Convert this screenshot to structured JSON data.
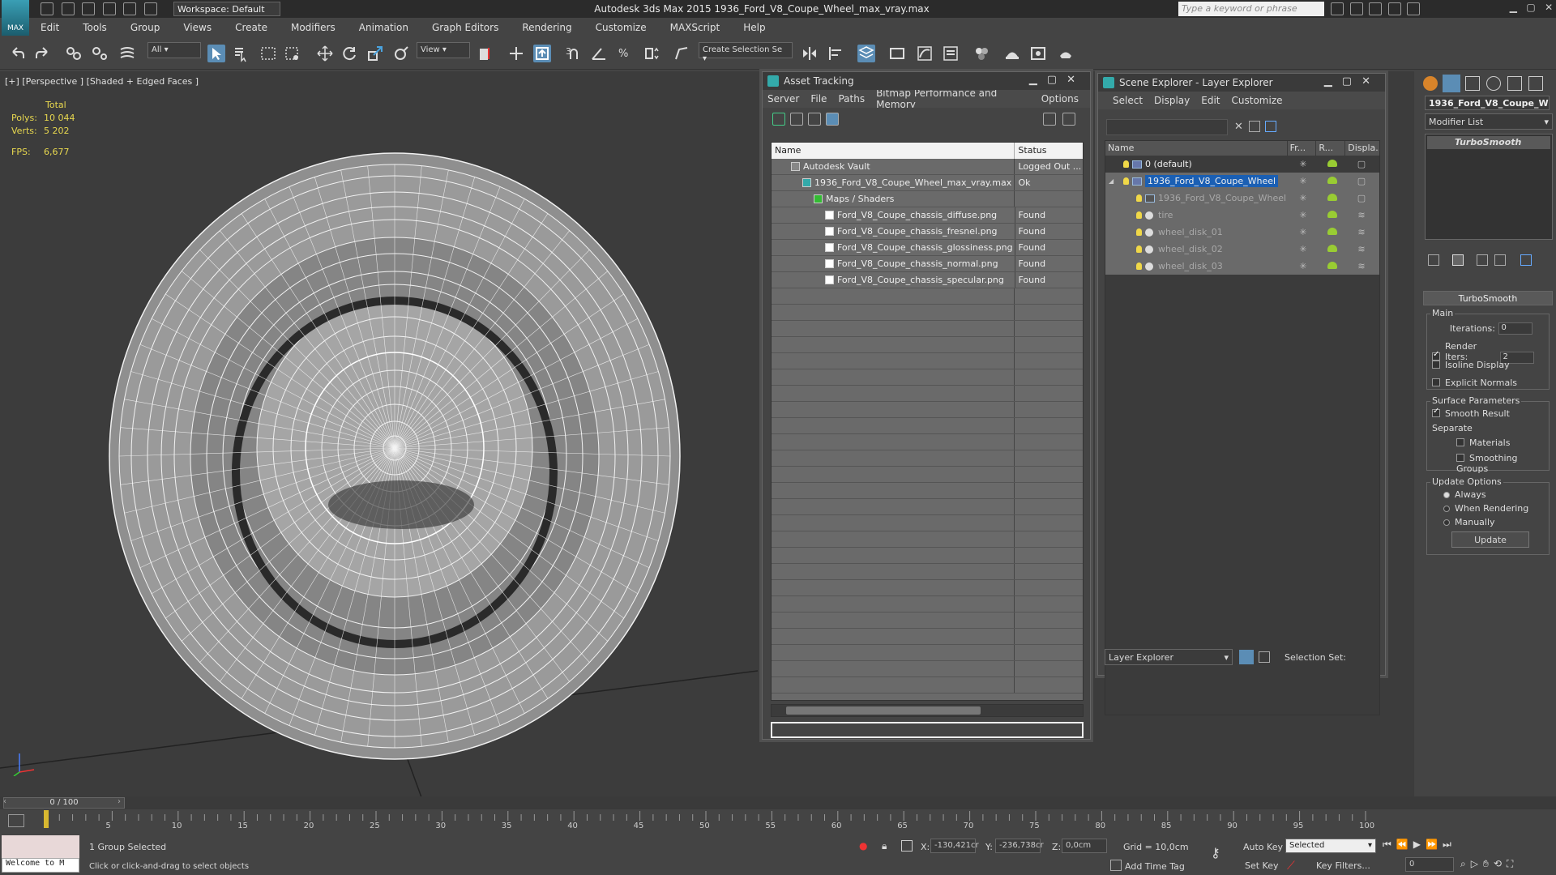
{
  "app": {
    "logo_label": "MAX",
    "workspace": "Workspace: Default",
    "title": "Autodesk 3ds Max  2015    1936_Ford_V8_Coupe_Wheel_max_vray.max",
    "search_placeholder": "Type a keyword or phrase"
  },
  "menu": [
    "Edit",
    "Tools",
    "Group",
    "Views",
    "Create",
    "Modifiers",
    "Animation",
    "Graph Editors",
    "Rendering",
    "Customize",
    "MAXScript",
    "Help"
  ],
  "toolbar": {
    "filter": "All",
    "ref_coord": "View",
    "selection_set": "Create Selection Se"
  },
  "viewport": {
    "label": "[+] [Perspective ] [Shaded + Edged Faces ]",
    "stats_total": "Total",
    "polys_label": "Polys:",
    "polys_value": "10 044",
    "verts_label": "Verts:",
    "verts_value": "5 202",
    "fps_label": "FPS:",
    "fps_value": "6,677"
  },
  "asset_tracking": {
    "title": "Asset Tracking",
    "menu": [
      "Server",
      "File",
      "Paths",
      "Bitmap Performance and Memory",
      "Options"
    ],
    "col_name": "Name",
    "col_status": "Status",
    "rows": [
      {
        "name": "Autodesk Vault",
        "status": "Logged Out ...",
        "indent": 0
      },
      {
        "name": "1936_Ford_V8_Coupe_Wheel_max_vray.max",
        "status": "Ok",
        "indent": 1
      },
      {
        "name": "Maps / Shaders",
        "status": "",
        "indent": 2
      },
      {
        "name": "Ford_V8_Coupe_chassis_diffuse.png",
        "status": "Found",
        "indent": 3
      },
      {
        "name": "Ford_V8_Coupe_chassis_fresnel.png",
        "status": "Found",
        "indent": 3
      },
      {
        "name": "Ford_V8_Coupe_chassis_glossiness.png",
        "status": "Found",
        "indent": 3
      },
      {
        "name": "Ford_V8_Coupe_chassis_normal.png",
        "status": "Found",
        "indent": 3
      },
      {
        "name": "Ford_V8_Coupe_chassis_specular.png",
        "status": "Found",
        "indent": 3
      }
    ]
  },
  "scene_explorer": {
    "title": "Scene Explorer - Layer Explorer",
    "menu": [
      "Select",
      "Display",
      "Edit",
      "Customize"
    ],
    "col_name": "Name",
    "col_freeze": "Fr...",
    "col_render": "R...",
    "col_display": "Displa...",
    "rows": [
      {
        "name": "0 (default)",
        "kind": "layer"
      },
      {
        "name": "1936_Ford_V8_Coupe_Wheel",
        "kind": "layer-selected"
      },
      {
        "name": "1936_Ford_V8_Coupe_Wheel",
        "kind": "child-group"
      },
      {
        "name": "tire",
        "kind": "child"
      },
      {
        "name": "wheel_disk_01",
        "kind": "child"
      },
      {
        "name": "wheel_disk_02",
        "kind": "child"
      },
      {
        "name": "wheel_disk_03",
        "kind": "child"
      }
    ],
    "footer_dropdown": "Layer Explorer",
    "footer_selection_set": "Selection Set:"
  },
  "command_panel": {
    "object_name": "1936_Ford_V8_Coupe_W",
    "modifier_list": "Modifier List",
    "stack_item": "TurboSmooth",
    "rollout_title": "TurboSmooth",
    "main_group": "Main",
    "iterations_label": "Iterations:",
    "iterations_value": "0",
    "render_iters_label": "Render Iters:",
    "render_iters_value": "2",
    "isoline": "Isoline Display",
    "explicit_normals": "Explicit Normals",
    "surface_group": "Surface Parameters",
    "smooth_result": "Smooth Result",
    "separate": "Separate",
    "materials": "Materials",
    "smoothing_groups": "Smoothing Groups",
    "update_group": "Update Options",
    "always": "Always",
    "when_rendering": "When Rendering",
    "manually": "Manually",
    "update_btn": "Update"
  },
  "timeline": {
    "frame": "0 / 100",
    "ticks": [
      "5",
      "10",
      "15",
      "20",
      "25",
      "30",
      "35",
      "40",
      "45",
      "50",
      "55",
      "60",
      "65",
      "70",
      "75",
      "80",
      "85",
      "90",
      "95",
      "100"
    ]
  },
  "status": {
    "welcome": "Welcome to M",
    "selected": "1 Group Selected",
    "prompt": "Click or click-and-drag to select objects",
    "x_label": "X:",
    "x_value": "-130,421cr",
    "y_label": "Y:",
    "y_value": "-236,738cr",
    "z_label": "Z:",
    "z_value": "0,0cm",
    "grid": "Grid = 10,0cm",
    "add_time_tag": "Add Time Tag",
    "auto_key": "Auto Key",
    "set_key": "Set Key",
    "key_mode": "Selected",
    "key_filters": "Key Filters...",
    "frame_field": "0"
  },
  "colors": {
    "accent": "#5b8db5",
    "selection": "#1a5fb4",
    "stats": "#e8d84f"
  }
}
